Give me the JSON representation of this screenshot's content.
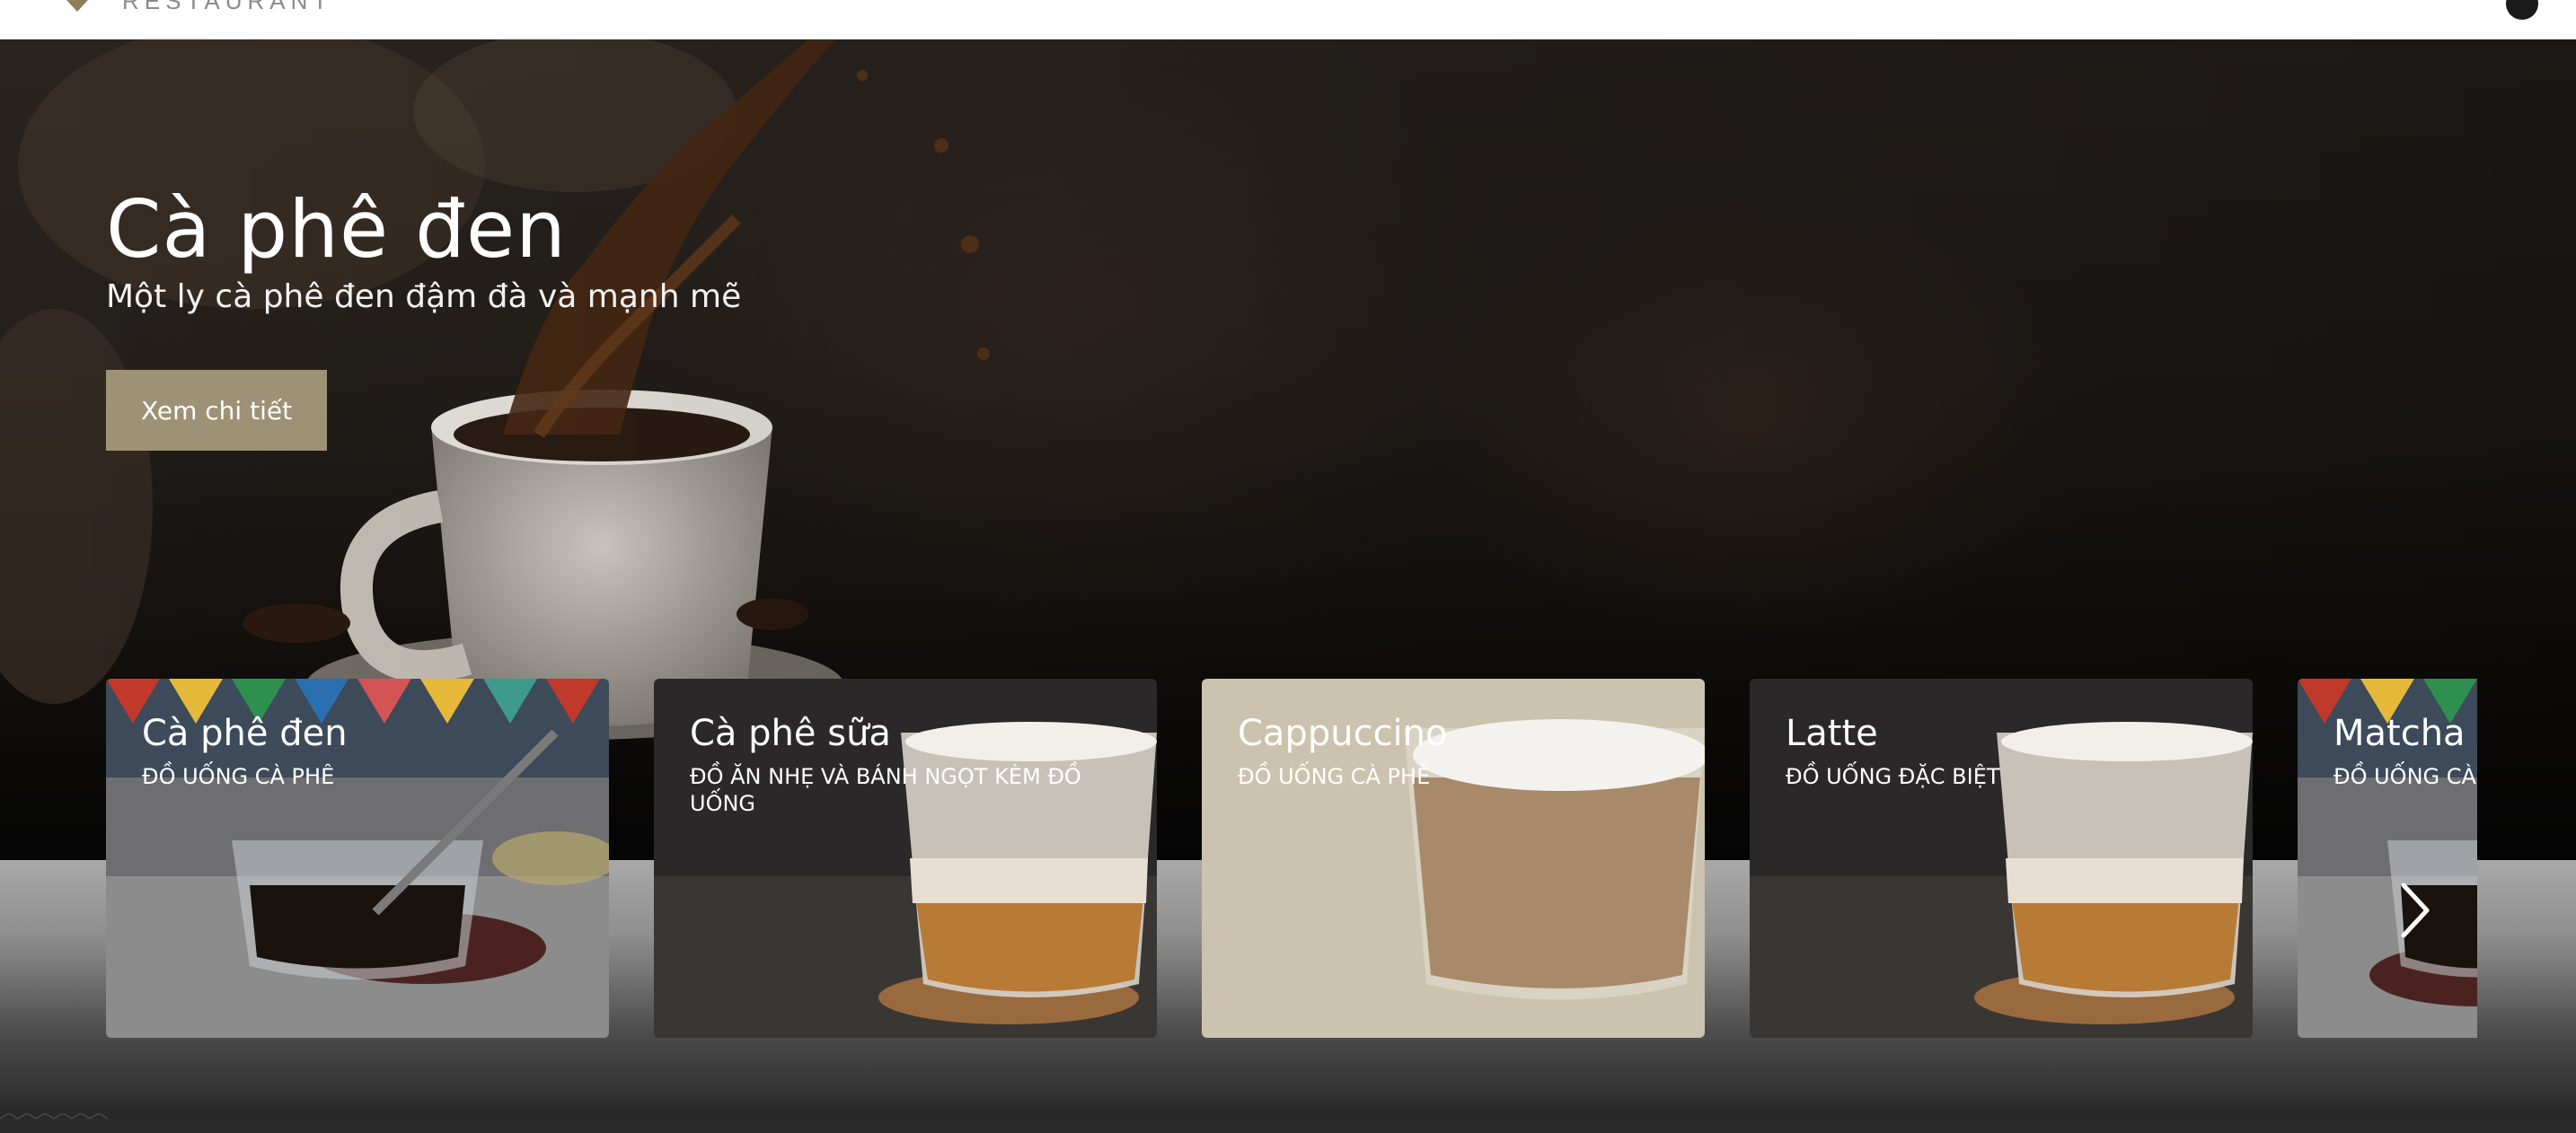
{
  "header": {
    "logo_text": "RESTAURANT",
    "logo_icon": "diamond-logo-icon",
    "account_icon": "user-icon"
  },
  "hero": {
    "title": "Cà phê đen",
    "subtitle": "Một ly cà phê đen đậm đà và mạnh mẽ",
    "button_label": "Xem chi tiết",
    "button_color": "#9e9276"
  },
  "carousel": {
    "next_icon": "chevron-right-icon",
    "cards": [
      {
        "title": "Cà phê đen",
        "category": "ĐỒ UỐNG CÀ PHÊ"
      },
      {
        "title": "Cà phê sữa",
        "category": "ĐỒ ĂN NHẸ VÀ BÁNH NGỌT KÈM ĐỒ UỐNG"
      },
      {
        "title": "Cappuccino",
        "category": "ĐỒ UỐNG CÀ PHÊ"
      },
      {
        "title": "Latte",
        "category": "ĐỒ UỐNG ĐẶC BIỆT"
      },
      {
        "title": "Matcha",
        "category": "ĐỒ UỐNG CÀ"
      }
    ]
  }
}
